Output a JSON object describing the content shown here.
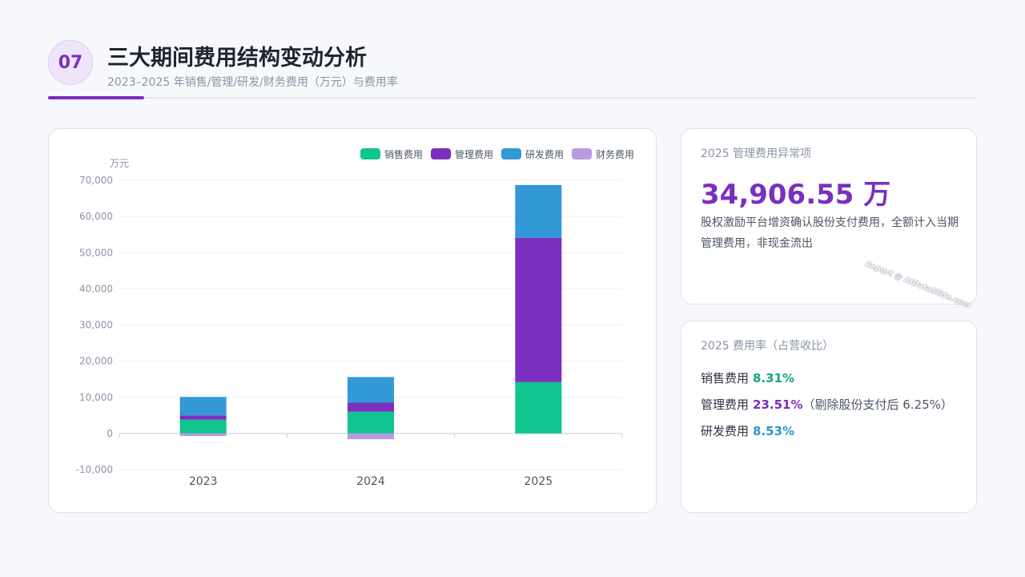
{
  "header": {
    "badge": "07",
    "title": "三大期间费用结构变动分析",
    "subtitle": "2023–2025 年销售/管理/研发/财务费用（万元）与费用率"
  },
  "colors": {
    "accent": "#7b2fbe",
    "sales": "#10c48f",
    "admin": "#7b2fbe",
    "rd": "#3398d6",
    "finance": "#b99ae0"
  },
  "chart_data": {
    "type": "bar",
    "stacked": true,
    "categories": [
      "2023",
      "2024",
      "2025"
    ],
    "series": [
      {
        "name": "销售费用",
        "values": [
          3800,
          6000,
          14200
        ]
      },
      {
        "name": "管理费用",
        "values": [
          1200,
          2500,
          39900
        ]
      },
      {
        "name": "研发费用",
        "values": [
          5100,
          7100,
          14600
        ]
      },
      {
        "name": "财务费用",
        "values": [
          -700,
          -1600,
          0
        ]
      }
    ],
    "ylabel": "万元",
    "ylim": [
      -10000,
      70000
    ],
    "yticks": [
      -10000,
      0,
      10000,
      20000,
      30000,
      40000,
      50000,
      60000,
      70000
    ],
    "ytick_labels": [
      "-10,000",
      "0",
      "10,000",
      "20,000",
      "30,000",
      "40,000",
      "50,000",
      "60,000",
      "70,000"
    ],
    "grid": true,
    "legend": "top-right"
  },
  "anomaly": {
    "label": "2025 管理费用异常项",
    "value": "34,906.55 万",
    "desc": "股权激励平台增资确认股份支付费用，全额计入当期管理费用，非现金流出",
    "watermark": "Report @ AIDataSlide.com"
  },
  "rates": {
    "label": "2025 费用率（占营收比）",
    "items": [
      {
        "name": "销售费用",
        "value": "8.31%",
        "note": ""
      },
      {
        "name": "管理费用",
        "value": "23.51%",
        "note": "（剔除股份支付后 6.25%）"
      },
      {
        "name": "研发费用",
        "value": "8.53%",
        "note": ""
      }
    ]
  }
}
